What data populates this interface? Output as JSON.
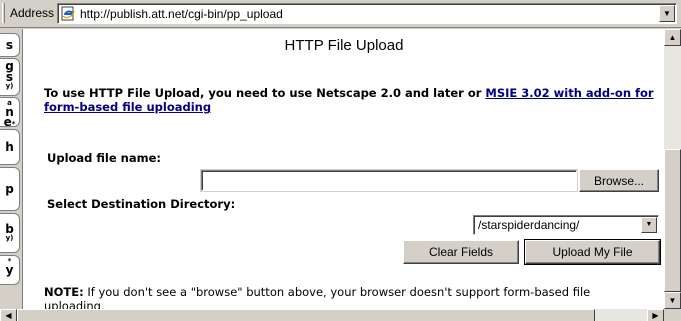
{
  "address_bar": {
    "label": "Address",
    "url": "http://publish.att.net/cgi-bin/pp_upload"
  },
  "sidebar": {
    "tabs": [
      {
        "main": "s",
        "sub": ""
      },
      {
        "main": "g",
        "sub": ""
      },
      {
        "main": "s",
        "sub": "y)"
      },
      {
        "main": "a",
        "sub": ""
      },
      {
        "main": "e",
        "sub": "*"
      },
      {
        "main": "h",
        "sub": ""
      },
      {
        "main": "p",
        "sub": ""
      },
      {
        "main": "b",
        "sub": "y)"
      },
      {
        "main": "y",
        "sub": "*"
      }
    ]
  },
  "page": {
    "title": "HTTP File Upload",
    "intro_text": "To use HTTP File Upload, you need to use Netscape 2.0 and later or ",
    "intro_link": "MSIE 3.02 with add-on for form-based file uploading",
    "upload_label": "Upload file name:",
    "upload_value": "",
    "browse_label": "Browse...",
    "dest_label": "Select Destination Directory:",
    "dest_selected": "/starspiderdancing/",
    "clear_label": "Clear Fields",
    "upload_button_label": "Upload My File",
    "note_label": "NOTE:",
    "note_text": " If you don't see a \"browse\" button above, your browser doesn't support form-based file uploading."
  },
  "icons": {
    "address_page": "ie-page-icon",
    "dropdown": "chevron-down-icon"
  },
  "colors": {
    "chrome": "#d4d0c8",
    "link": "#000080",
    "content_bg": "#ffffff"
  }
}
